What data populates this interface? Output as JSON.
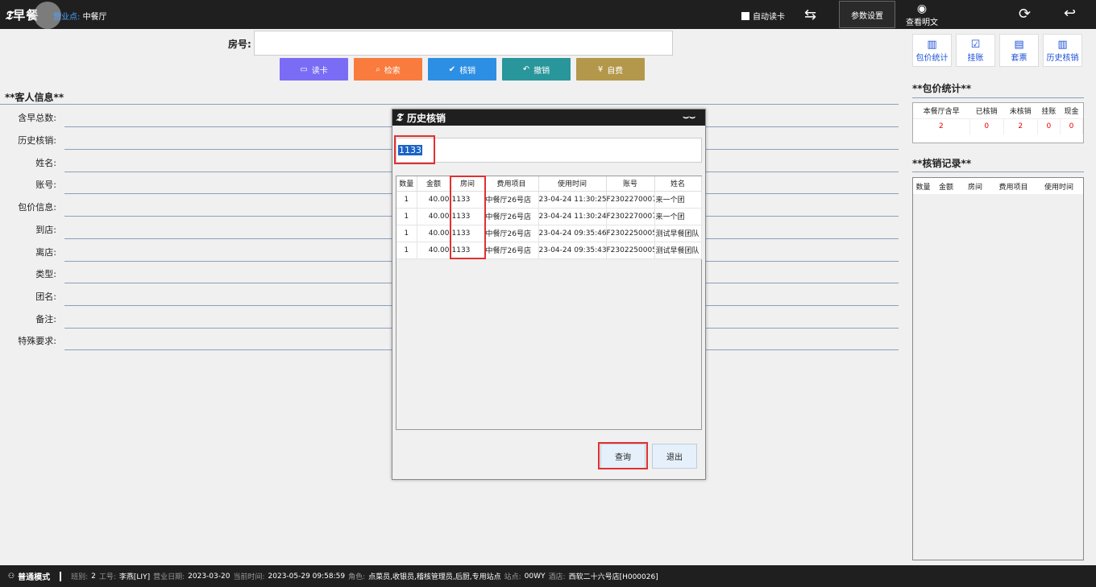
{
  "topbar": {
    "logo_text": "早餐",
    "venue_label": "营业点:",
    "venue_value": "中餐厅",
    "auto_read_label": "自动读卡",
    "param_settings_label": "参数设置",
    "view_plain_label": "查看明文"
  },
  "main": {
    "room_label": "房号:",
    "room_value": "",
    "buttons": [
      {
        "label": "读卡",
        "color": "#7b6cf6"
      },
      {
        "label": "检索",
        "color": "#f97b3d"
      },
      {
        "label": "核销",
        "color": "#2d8fe3"
      },
      {
        "label": "撤销",
        "color": "#28969a"
      },
      {
        "label": "自费",
        "color": "#b3974a"
      }
    ],
    "guest_title": "**客人信息**",
    "fields": [
      "含早总数:",
      "历史核销:",
      "姓名:",
      "账号:",
      "包价信息:",
      "到店:",
      "离店:",
      "类型:",
      "团名:",
      "备注:",
      "特殊要求:"
    ]
  },
  "right": {
    "tools": [
      "包价统计",
      "挂账",
      "套票",
      "历史核销"
    ],
    "package_title": "**包价统计**",
    "package_headers": [
      "本餐厅含早",
      "已核销",
      "未核销",
      "挂账",
      "现金"
    ],
    "package_values": [
      "2",
      "0",
      "2",
      "0",
      "0"
    ],
    "record_title": "**核销记录**",
    "record_headers": [
      "数量",
      "金额",
      "房间",
      "费用项目",
      "使用时间"
    ]
  },
  "dialog": {
    "title": "历史核销",
    "search_value": "1133",
    "headers": [
      "数量",
      "金额",
      "房间",
      "费用项目",
      "使用时间",
      "账号",
      "姓名"
    ],
    "rows": [
      [
        "1",
        "40.00",
        "1133",
        "中餐厅26号店",
        "23-04-24 11:30:25",
        "F2302270007",
        "来一个团"
      ],
      [
        "1",
        "40.00",
        "1133",
        "中餐厅26号店",
        "23-04-24 11:30:24",
        "F2302270007",
        "来一个团"
      ],
      [
        "1",
        "40.00",
        "1133",
        "中餐厅26号店",
        "23-04-24 09:35:46",
        "F2302250005",
        "测试早餐团队"
      ],
      [
        "1",
        "40.00",
        "1133",
        "中餐厅26号店",
        "23-04-24 09:35:43",
        "F2302250005",
        "测试早餐团队"
      ]
    ],
    "query_label": "查询",
    "exit_label": "退出"
  },
  "status": {
    "mode": "普通模式",
    "shift_label": "班别:",
    "shift_value": "2",
    "staff_label": "工号:",
    "staff_value": "李燕[LIY]",
    "bizdate_label": "营业日期:",
    "bizdate_value": "2023-03-20",
    "curtime_label": "当前时间:",
    "curtime_value": "2023-05-29 09:58:59",
    "role_label": "角色:",
    "role_value": "点菜员,收银员,稽核管理员,后厨,专用站点",
    "site_label": "站点:",
    "site_value": "00WY",
    "hotel_label": "酒店:",
    "hotel_value": "西软二十六号店[H000026]"
  }
}
